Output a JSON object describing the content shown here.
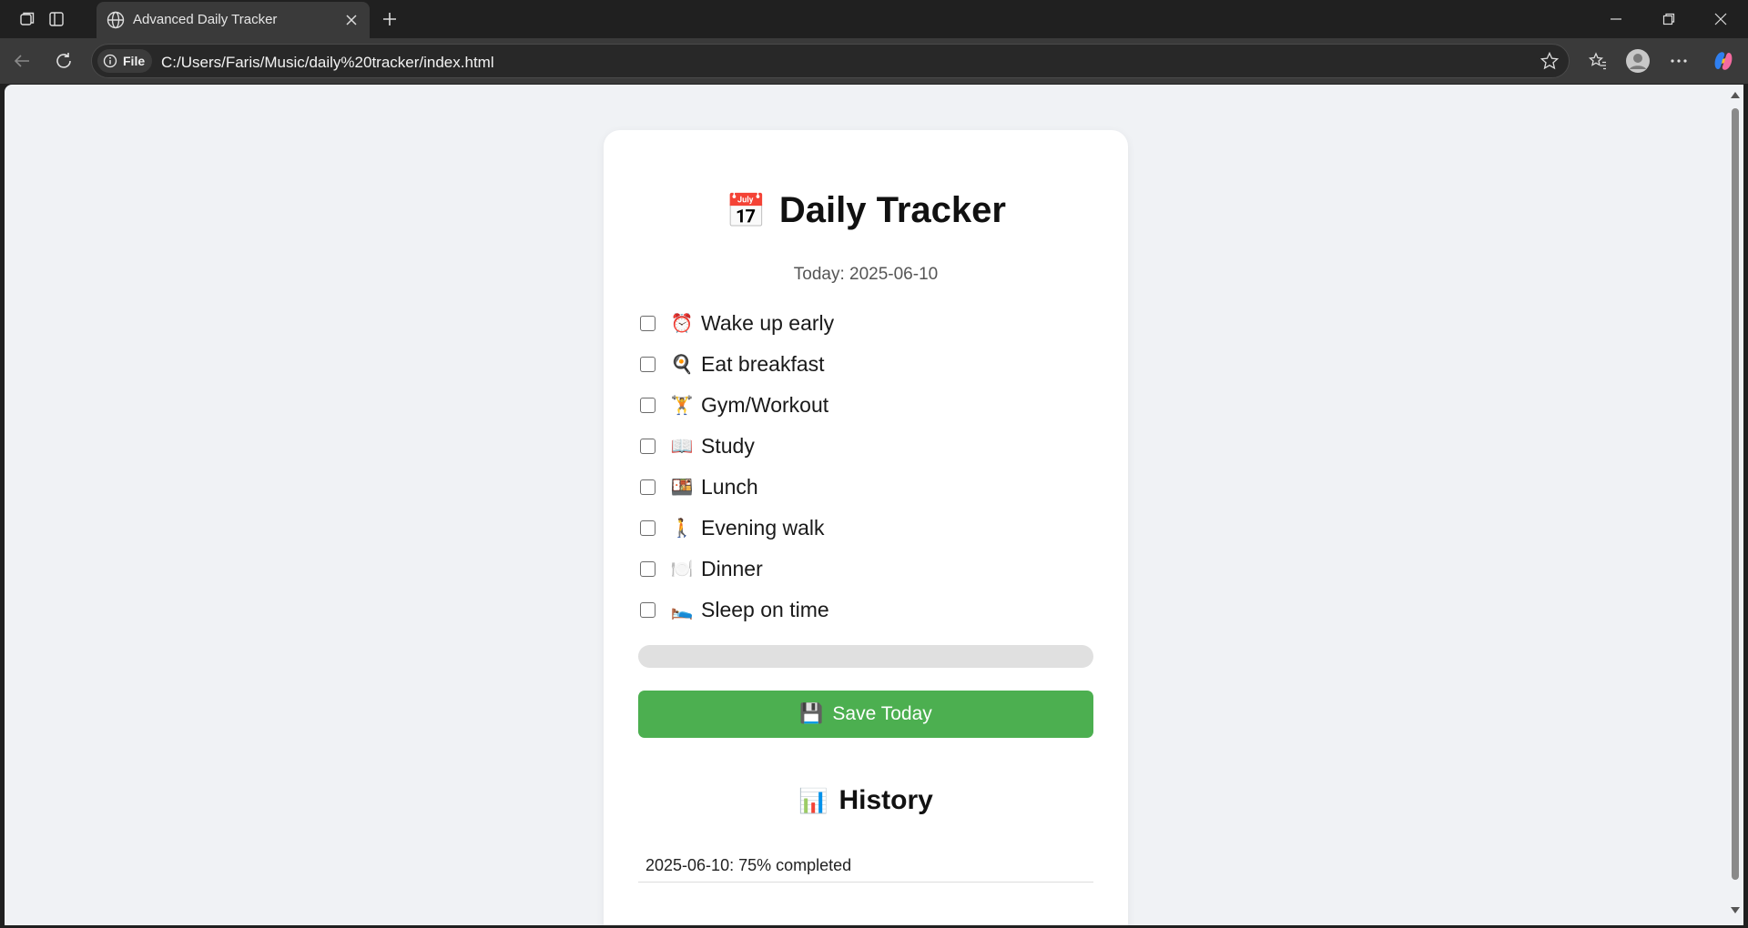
{
  "browser": {
    "tab_title": "Advanced Daily Tracker",
    "file_chip": "File",
    "url": "C:/Users/Faris/Music/daily%20tracker/index.html"
  },
  "page": {
    "title_emoji": "📅",
    "title": "Daily Tracker",
    "today_text": "Today: 2025-06-10",
    "tasks": [
      {
        "emoji": "⏰",
        "label": "Wake up early",
        "checked": false
      },
      {
        "emoji": "🍳",
        "label": "Eat breakfast",
        "checked": false
      },
      {
        "emoji": "🏋️",
        "label": "Gym/Workout",
        "checked": false
      },
      {
        "emoji": "📖",
        "label": "Study",
        "checked": false
      },
      {
        "emoji": "🍱",
        "label": "Lunch",
        "checked": false
      },
      {
        "emoji": "🚶",
        "label": "Evening walk",
        "checked": false
      },
      {
        "emoji": "🍽️",
        "label": "Dinner",
        "checked": false
      },
      {
        "emoji": "🛌",
        "label": "Sleep on time",
        "checked": false
      }
    ],
    "progress_percent": 0,
    "save_emoji": "💾",
    "save_label": "Save Today",
    "history_emoji": "📊",
    "history_title": "History",
    "history": [
      "2025-06-10: 75% completed"
    ]
  },
  "colors": {
    "accent": "#4caf50",
    "background": "#f0f2f5",
    "progress_track": "#e0e0e0"
  }
}
